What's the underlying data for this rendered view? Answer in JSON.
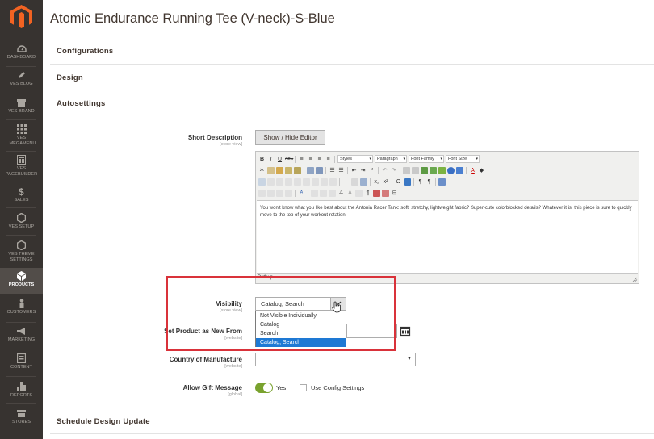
{
  "page": {
    "title": "Atomic Endurance Running Tee (V-neck)-S-Blue"
  },
  "sidebar": {
    "items": [
      {
        "label": "DASHBOARD",
        "icon": "dashboard-icon"
      },
      {
        "label": "VES BLOG",
        "icon": "pencil-icon"
      },
      {
        "label": "VES BRAND",
        "icon": "store-icon"
      },
      {
        "label": "VES MEGAMENU",
        "icon": "grid-icon"
      },
      {
        "label": "VES PAGEBUILDER",
        "icon": "layout-icon"
      },
      {
        "label": "SALES",
        "icon": "dollar-icon"
      },
      {
        "label": "VES SETUP",
        "icon": "hexagon-icon"
      },
      {
        "label": "VES THEME SETTINGS",
        "icon": "hexagon-icon"
      },
      {
        "label": "PRODUCTS",
        "icon": "cube-icon"
      },
      {
        "label": "CUSTOMERS",
        "icon": "person-icon"
      },
      {
        "label": "MARKETING",
        "icon": "megaphone-icon"
      },
      {
        "label": "CONTENT",
        "icon": "content-icon"
      },
      {
        "label": "REPORTS",
        "icon": "bar-chart-icon"
      },
      {
        "label": "STORES",
        "icon": "store-icon"
      }
    ]
  },
  "sections": {
    "configurations": "Configurations",
    "design": "Design",
    "autosettings": "Autosettings",
    "schedule": "Schedule Design Update"
  },
  "short_description": {
    "label": "Short Description",
    "scope": "[store view]",
    "toggle_button": "Show / Hide Editor",
    "content": "You won't know what you like best about the Antonia Racer Tank: soft, stretchy, lightweight fabric? Super-cute colorblocked details? Whatever it is, this piece is sure to quickly move to the top of your workout rotation.",
    "path": "Path: p",
    "toolbar": {
      "styles": "Styles",
      "paragraph": "Paragraph",
      "font_family": "Font Family",
      "font_size": "Font Size"
    }
  },
  "visibility": {
    "label": "Visibility",
    "scope": "[store view]",
    "value": "Catalog, Search",
    "options": [
      "Not Visible Individually",
      "Catalog",
      "Search",
      "Catalog, Search"
    ]
  },
  "new_from": {
    "label": "Set Product as New From",
    "scope": "[website]"
  },
  "country": {
    "label": "Country of Manufacture",
    "scope": "[website]"
  },
  "gift": {
    "label": "Allow Gift Message",
    "scope": "[global]",
    "toggle_value": "Yes",
    "config_label": "Use Config Settings"
  },
  "colors": {
    "sidebar": "#373330",
    "active": "#524d49",
    "toggle": "#79a22e",
    "selected_option": "#1e79d4",
    "highlight": "#d9323a",
    "logo": "#f26322"
  }
}
